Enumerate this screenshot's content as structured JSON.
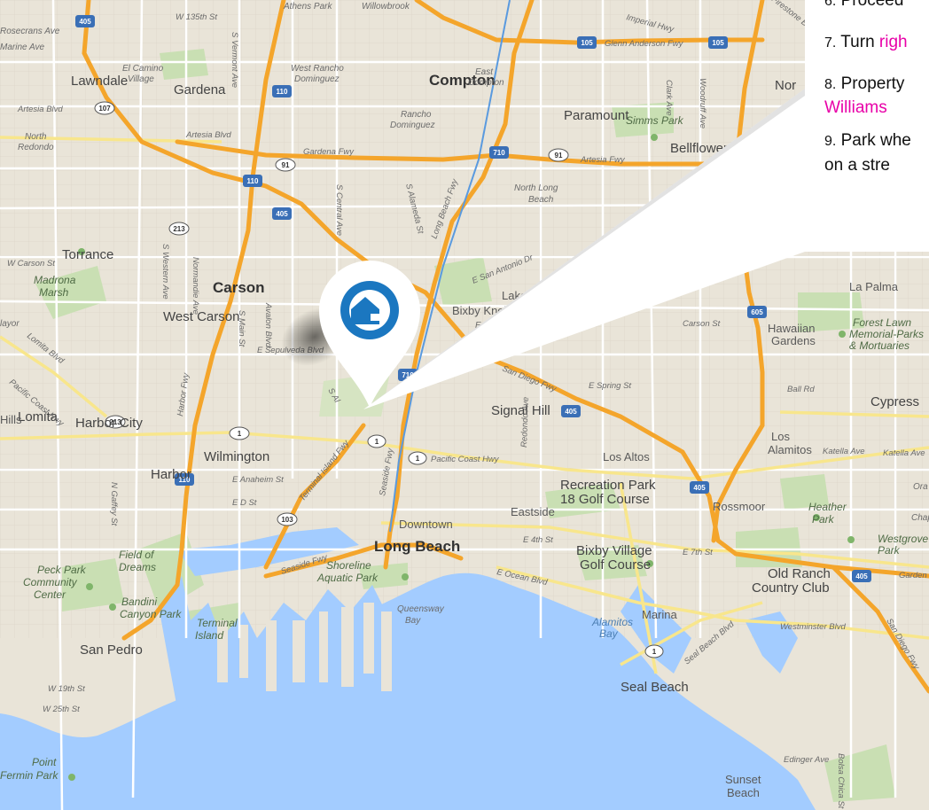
{
  "directions": {
    "step6": {
      "num": "6.",
      "text": "Proceed"
    },
    "step7": {
      "num": "7.",
      "text": "Turn ",
      "highlight": "righ"
    },
    "step8": {
      "num": "8.",
      "text": "Property",
      "line2_highlight": "Williams"
    },
    "step9": {
      "num": "9.",
      "text": "Park whe",
      "line2": "on a stre"
    }
  },
  "map": {
    "cities": {
      "compton": "Compton",
      "gardena": "Gardena",
      "torrance": "Torrance",
      "carson": "Carson",
      "west_carson": "West Carson",
      "lomita": "Lomita",
      "harbor_city": "Harbor City",
      "wilmington": "Wilmington",
      "harbor": "Harbor",
      "san_pedro": "San Pedro",
      "long_beach": "Long Beach",
      "signal_hill": "Signal Hill",
      "paramount": "Paramount",
      "bellflower": "Bellflower",
      "lawndale": "Lawndale",
      "cypress": "Cypress",
      "seal_beach": "Seal Beach",
      "los_altos": "Los Altos",
      "eastside": "Eastside",
      "los_alamitos_1": "Los",
      "los_alamitos_2": "Alamitos",
      "rossmoor": "Rossmoor",
      "la_palma": "La Palma",
      "downtown": "Downtown",
      "marina": "Marina",
      "north_long_beach_1": "North Long",
      "north_long_beach_2": "Beach",
      "bixby_knolls": "Bixby Knolls",
      "hawaiian_gardens_1": "Hawaiian",
      "hawaiian_gardens_2": "Gardens",
      "east_compton_1": "East",
      "east_compton_2": "Compton",
      "rancho_dominguez_1": "Rancho",
      "rancho_dominguez_2": "Dominguez",
      "west_rancho_1": "West Rancho",
      "west_rancho_2": "Dominguez",
      "el_camino_1": "El Camino",
      "el_camino_2": "Village",
      "north_redondo_1": "North",
      "north_redondo_2": "Redondo",
      "athens_park": "Athens Park",
      "willowbrook": "Willowbrook",
      "lakewood_frag": "Lak",
      "nor_frag": "Nor",
      "esia_frag": "esia",
      "hills_frag": "Hills",
      "layor_frag": "layor",
      "rosecrans": "Rosecrans Ave",
      "marine": "Marine Ave",
      "bixby_rd": "E Bixby",
      "lake_frag": "Lake",
      "go_frag": "Go",
      "la_frag": "La",
      "ora_frag": "Ora",
      "cha_frag": "Chap"
    },
    "parks": {
      "madrona_1": "Madrona",
      "madrona_2": "Marsh",
      "simms": "Simms Park",
      "forest_lawn_1": "Forest Lawn",
      "forest_lawn_2": "Memorial-Parks",
      "forest_lawn_3": "& Mortuaries",
      "recreation_1": "Recreation Park",
      "recreation_2": "18 Golf Course",
      "bixby_village_1": "Bixby Village",
      "bixby_village_2": "Golf Course",
      "heather_1": "Heather",
      "heather_2": "Park",
      "westgrove_1": "Westgrove",
      "westgrove_2": "Park",
      "old_ranch_1": "Old Ranch",
      "old_ranch_2": "Country Club",
      "field_1": "Field of",
      "field_2": "Dreams",
      "peck_1": "Peck Park",
      "peck_2": "Community",
      "peck_3": "Center",
      "bandini_1": "Bandini",
      "bandini_2": "Canyon Park",
      "terminal_1": "Terminal",
      "terminal_2": "Island",
      "shoreline_1": "Shoreline",
      "shoreline_2": "Aquatic Park",
      "queensway_1": "Queensway",
      "queensway_2": "Bay",
      "alamitos_bay_1": "Alamitos",
      "alamitos_bay_2": "Bay",
      "point_fermin_1": "Point",
      "point_fermin_2": "Fermin Park",
      "sunset_1": "Sunset",
      "sunset_2": "Beach"
    },
    "roads": {
      "glenn_anderson": "Glenn Anderson Fwy",
      "gardena_fwy": "Gardena Fwy",
      "artesia_fwy": "Artesia Fwy",
      "artesia_blvd_w": "Artesia Blvd",
      "artesia_blvd": "Artesia Blvd",
      "san_diego_fwy": "San Diego Fwy",
      "san_diego_fwy_se": "San Diego Fwy",
      "long_beach_fwy": "Long Beach Fwy",
      "harbor_fwy": "Harbor Fwy",
      "terminal_island_fwy": "Terminal Island Fwy",
      "seaside_fwy": "Seaside Fwy",
      "seaside_fwy_2": "Seaside Fwy",
      "pacific_coast_hwy": "Pacific Coast Hwy",
      "pacific_coast_hwy_w": "Pacific Coast Hwy",
      "e_7th": "E 7th St",
      "e_4th": "E 4th St",
      "ocean_blvd": "E Ocean Blvd",
      "sepulveda": "E Sepulveda Blvd",
      "anaheim": "E Anaheim St",
      "e_d_st": "E D St",
      "carson_st": "Carson St",
      "spring_st": "E Spring St",
      "ball_rd": "Ball Rd",
      "katella": "Katella Ave",
      "katella_2": "Katella Ave",
      "westminster": "Westminster Blvd",
      "seal_beach_blvd": "Seal Beach Blvd",
      "edinger": "Edinger Ave",
      "bolsa_chica": "Bolsa Chica St",
      "w_carson": "W Carson St",
      "w_19th": "W 19th St",
      "w_25th": "W 25th St",
      "w_135th": "W 135th St",
      "lomita_blvd": "Lomita Blvd",
      "western": "S Western Ave",
      "normandie": "Normandie Ave",
      "vermont": "S Vermont Ave",
      "central": "S Central Ave",
      "alameda": "S Alameda St",
      "main": "S Main St",
      "avalon": "Avalon Blvd",
      "redondo": "Redondo Ave",
      "gaffey": "N Gaffey St",
      "clark": "Clark Ave",
      "woodruff": "Woodruff Ave",
      "imperial": "Imperial Hwy",
      "firestone": "Firestone Blvd",
      "e_san_antonio": "E San Antonio Dr",
      "pacific_coast_hwy_sw": "Pacific Coast Hwy",
      "garden_grove": "Garden G",
      "s_al": "S Al",
      "alameda_2": "S Alameda St",
      "seaside_fwy_3": "Seaside Fwy"
    },
    "shields": [
      "405",
      "110",
      "105",
      "91",
      "710",
      "605",
      "1",
      "213",
      "107",
      "103"
    ]
  },
  "colors": {
    "highway": "#f4a52b",
    "water": "#a3ccff",
    "land": "#e9e4d8",
    "pin": "#1b77c0",
    "highlight": "#e800a8"
  }
}
